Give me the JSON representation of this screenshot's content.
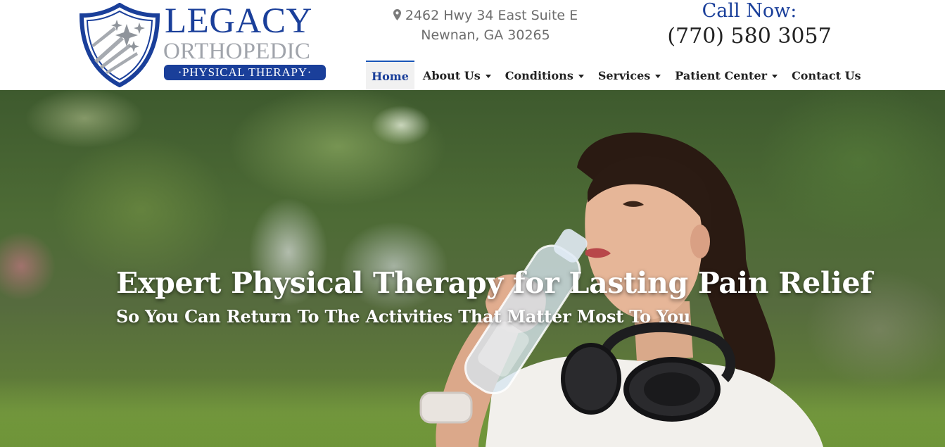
{
  "brand": {
    "name_line1": "LEGACY",
    "name_line2": "ORTHOPEDIC",
    "tagline": "·PHYSICAL THERAPY·",
    "primary_color": "#1a3f9a",
    "secondary_color": "#a0a4ab"
  },
  "address": {
    "icon": "map-pin-icon",
    "line1": "2462 Hwy 34 East Suite E",
    "line2": "Newnan, GA 30265"
  },
  "call": {
    "label": "Call Now:",
    "phone": "(770) 580 3057"
  },
  "nav": {
    "items": [
      {
        "label": "Home",
        "active": true,
        "dropdown": false
      },
      {
        "label": "About Us",
        "active": false,
        "dropdown": true
      },
      {
        "label": "Conditions",
        "active": false,
        "dropdown": true
      },
      {
        "label": "Services",
        "active": false,
        "dropdown": true
      },
      {
        "label": "Patient Center",
        "active": false,
        "dropdown": true
      },
      {
        "label": "Contact Us",
        "active": false,
        "dropdown": false
      }
    ]
  },
  "hero": {
    "title": "Expert Physical Therapy for Lasting Pain Relief",
    "subtitle": "So You Can Return To The Activities That Matter Most To You"
  }
}
